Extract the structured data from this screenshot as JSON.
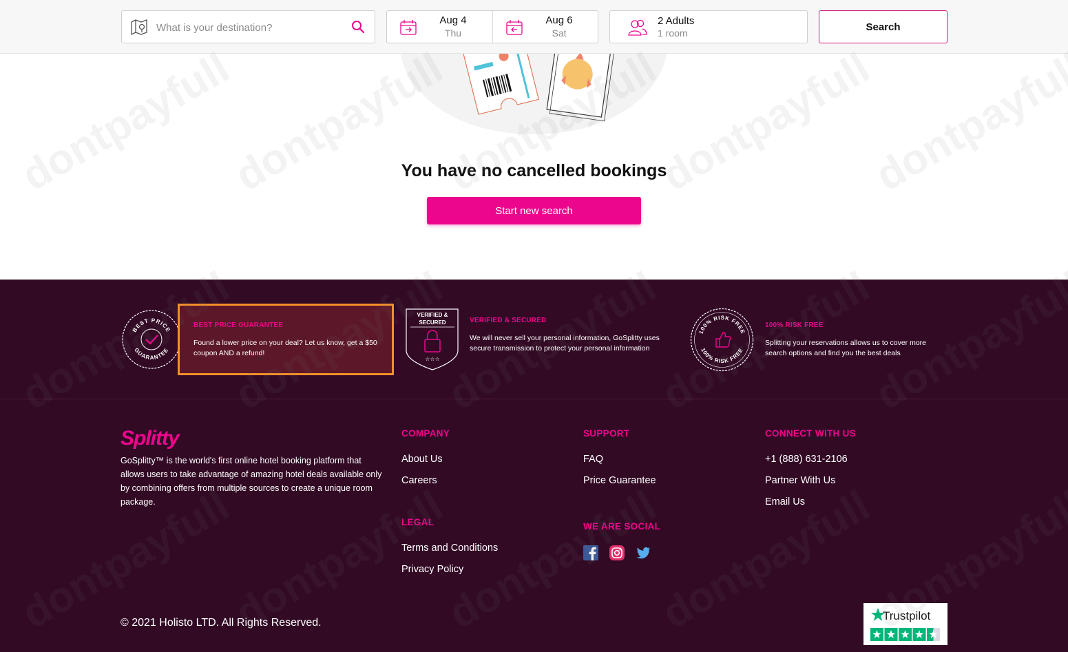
{
  "header": {
    "destination_placeholder": "What is your destination?",
    "checkin": {
      "date": "Aug 4",
      "day": "Thu"
    },
    "checkout": {
      "date": "Aug 6",
      "day": "Sat"
    },
    "guests": {
      "adults": "2 Adults",
      "rooms": "1 room"
    },
    "search_label": "Search"
  },
  "main": {
    "empty_title": "You have no cancelled bookings",
    "new_search_label": "Start new search"
  },
  "badges": [
    {
      "title": "BEST PRICE GUARANTEE",
      "text": "Found a lower price on your deal? Let us know, get a $50 coupon AND a refund!",
      "seal_top": "BEST PRICE",
      "seal_bottom": "GUARANTEE"
    },
    {
      "title": "VERIFIED & SECURED",
      "text": "We will never sell your personal information, GoSplitty uses secure transmission to protect your personal information",
      "seal_line1": "VERIFIED &",
      "seal_line2": "SECURED"
    },
    {
      "title": "100% RISK FREE",
      "text": "Splitting your reservations allows us to cover more search options and find you the best deals",
      "seal_top": "100% RISK FREE",
      "seal_bottom": "100% RISK FREE"
    }
  ],
  "footer": {
    "logo": "Splitty",
    "about": "GoSplitty™ is the world's first online hotel booking platform that allows users to take advantage of amazing hotel deals available only by combining offers from multiple sources to create a unique room package.",
    "company": {
      "title": "COMPANY",
      "links": [
        "About Us",
        "Careers"
      ]
    },
    "legal": {
      "title": "LEGAL",
      "links": [
        "Terms and Conditions",
        "Privacy Policy"
      ]
    },
    "support": {
      "title": "SUPPORT",
      "links": [
        "FAQ",
        "Price Guarantee"
      ]
    },
    "social": {
      "title": "WE ARE SOCIAL",
      "icons": [
        "facebook-icon",
        "instagram-icon",
        "twitter-icon"
      ]
    },
    "connect": {
      "title": "CONNECT WITH US",
      "links": [
        "+1 (888) 631-2106",
        "Partner With Us",
        "Email Us"
      ]
    },
    "copyright": "© 2021 Holisto LTD. All Rights Reserved.",
    "trustpilot": "Trustpilot"
  },
  "watermark": "dontpayfull",
  "colors": {
    "brand_pink": "#ec068d",
    "footer_bg": "#320a24",
    "highlight_border": "#f6902a",
    "trustpilot_green": "#00b67a"
  }
}
